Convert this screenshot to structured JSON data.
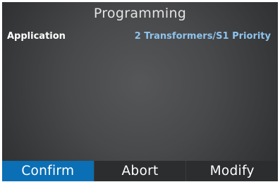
{
  "screen": {
    "title": "Programming"
  },
  "setting": {
    "label": "Application",
    "value": "2 Transformers/S1 Priority"
  },
  "softkeys": [
    {
      "label": "Confirm",
      "selected": true
    },
    {
      "label": "Abort",
      "selected": false
    },
    {
      "label": "Modify",
      "selected": false
    }
  ],
  "colors": {
    "selected_key_bg": "#0a6fb5",
    "value_text": "#8ec3ec",
    "key_bg": "#2c2d2f"
  }
}
